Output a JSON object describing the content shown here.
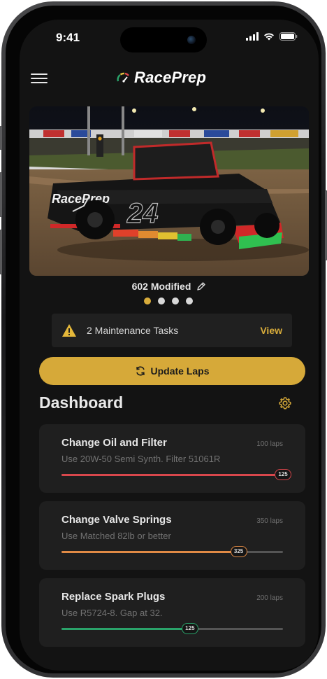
{
  "status_bar": {
    "time": "9:41"
  },
  "app": {
    "name": "RacePrep"
  },
  "car": {
    "name": "602 Modified",
    "number": "24",
    "carousel_total": 4,
    "carousel_active": 0
  },
  "alert": {
    "text": "2 Maintenance Tasks",
    "action": "View"
  },
  "update_button": {
    "label": "Update Laps"
  },
  "dashboard": {
    "title": "Dashboard",
    "tasks": [
      {
        "title": "Change Oil and Filter",
        "description": "Use 20W-50 Semi Synth. Filter 51061R",
        "interval": "100 laps",
        "laps": "125",
        "progress": 1.0,
        "color": "#d8474c"
      },
      {
        "title": "Change Valve Springs",
        "description": "Use Matched 82lb or better",
        "interval": "350 laps",
        "laps": "325",
        "progress": 0.8,
        "color": "#e08a45"
      },
      {
        "title": "Replace Spark Plugs",
        "description": "Use R5724-8. Gap at 32.",
        "interval": "200 laps",
        "laps": "125",
        "progress": 0.58,
        "color": "#2aa36a"
      }
    ]
  },
  "colors": {
    "accent": "#d6a939",
    "background": "#131313",
    "card": "#1f1f1f"
  }
}
